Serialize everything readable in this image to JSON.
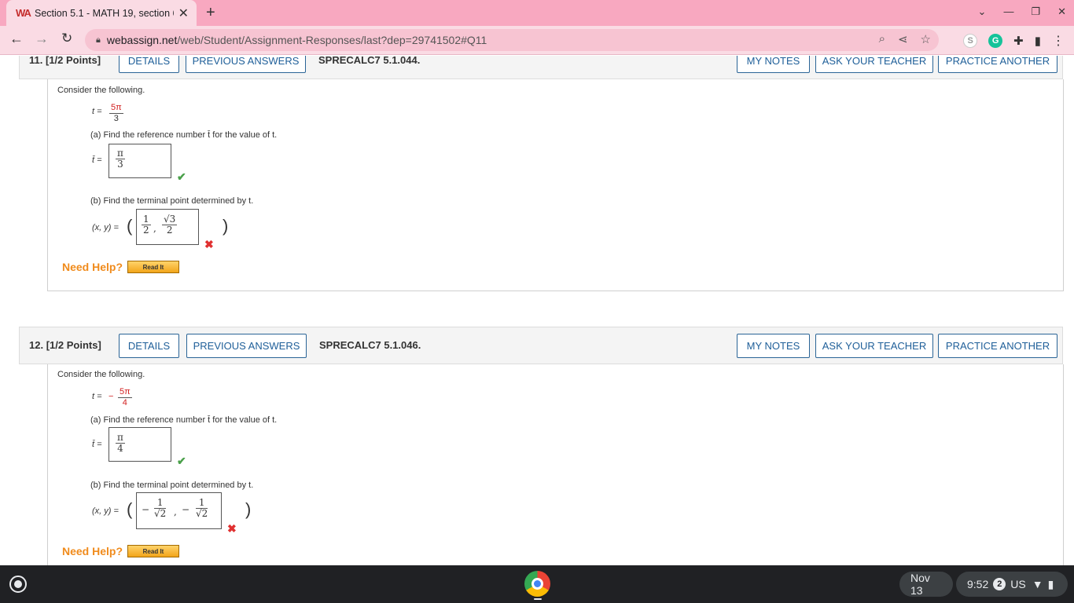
{
  "browser": {
    "tab_title": "Section 5.1 - MATH 19, section 6",
    "tab_logo": "WA",
    "new_tab_icon": "+",
    "url_host": "webassign.net",
    "url_path": "/web/Student/Assignment-Responses/last?dep=29741502#Q11"
  },
  "questions": [
    {
      "number": "11.",
      "points": "[1/2 Points]",
      "details_label": "DETAILS",
      "previous_label": "PREVIOUS ANSWERS",
      "code": "SPRECALC7 5.1.044.",
      "notes_label": "MY NOTES",
      "ask_label": "ASK YOUR TEACHER",
      "practice_label": "PRACTICE ANOTHER",
      "intro": "Consider the following.",
      "t_label": "t =",
      "t_sign": "",
      "t_num": "5π",
      "t_den": "3",
      "part_a": "(a) Find the reference number t̄ for the value of t.",
      "tbar_label": "t̄ =",
      "ans_a_num": "π",
      "ans_a_den": "3",
      "part_b": "(b) Find the terminal point determined by t.",
      "xy_label": "(x, y) =",
      "need_help": "Need Help?",
      "read_it": "Read It"
    },
    {
      "number": "12.",
      "points": "[1/2 Points]",
      "details_label": "DETAILS",
      "previous_label": "PREVIOUS ANSWERS",
      "code": "SPRECALC7 5.1.046.",
      "notes_label": "MY NOTES",
      "ask_label": "ASK YOUR TEACHER",
      "practice_label": "PRACTICE ANOTHER",
      "intro": "Consider the following.",
      "t_label": "t =",
      "t_sign": "−",
      "t_num": "5π",
      "t_den": "4",
      "part_a": "(a) Find the reference number t̄ for the value of t.",
      "tbar_label": "t̄ =",
      "ans_a_num": "π",
      "ans_a_den": "4",
      "part_b": "(b) Find the terminal point determined by t.",
      "xy_label": "(x, y) =",
      "need_help": "Need Help?",
      "read_it": "Read It"
    }
  ],
  "q11_b": {
    "x_num": "1",
    "x_den": "2",
    "y_num": "√3",
    "y_den": "2",
    "sep": ","
  },
  "q12_b": {
    "x_sign": "−",
    "x_num": "1",
    "x_den": "√2",
    "sep": ",",
    "y_sign": "−",
    "y_num": "1",
    "y_den": "√2"
  },
  "shelf": {
    "date": "Nov 13",
    "time": "9:52",
    "notif_count": "2",
    "locale": "US"
  },
  "colors": {
    "accent_link": "#1f5f99",
    "tab_bar": "#f8a8c0",
    "need_help": "#f08b1c",
    "correct": "#4aa04a",
    "incorrect": "#e03030"
  }
}
